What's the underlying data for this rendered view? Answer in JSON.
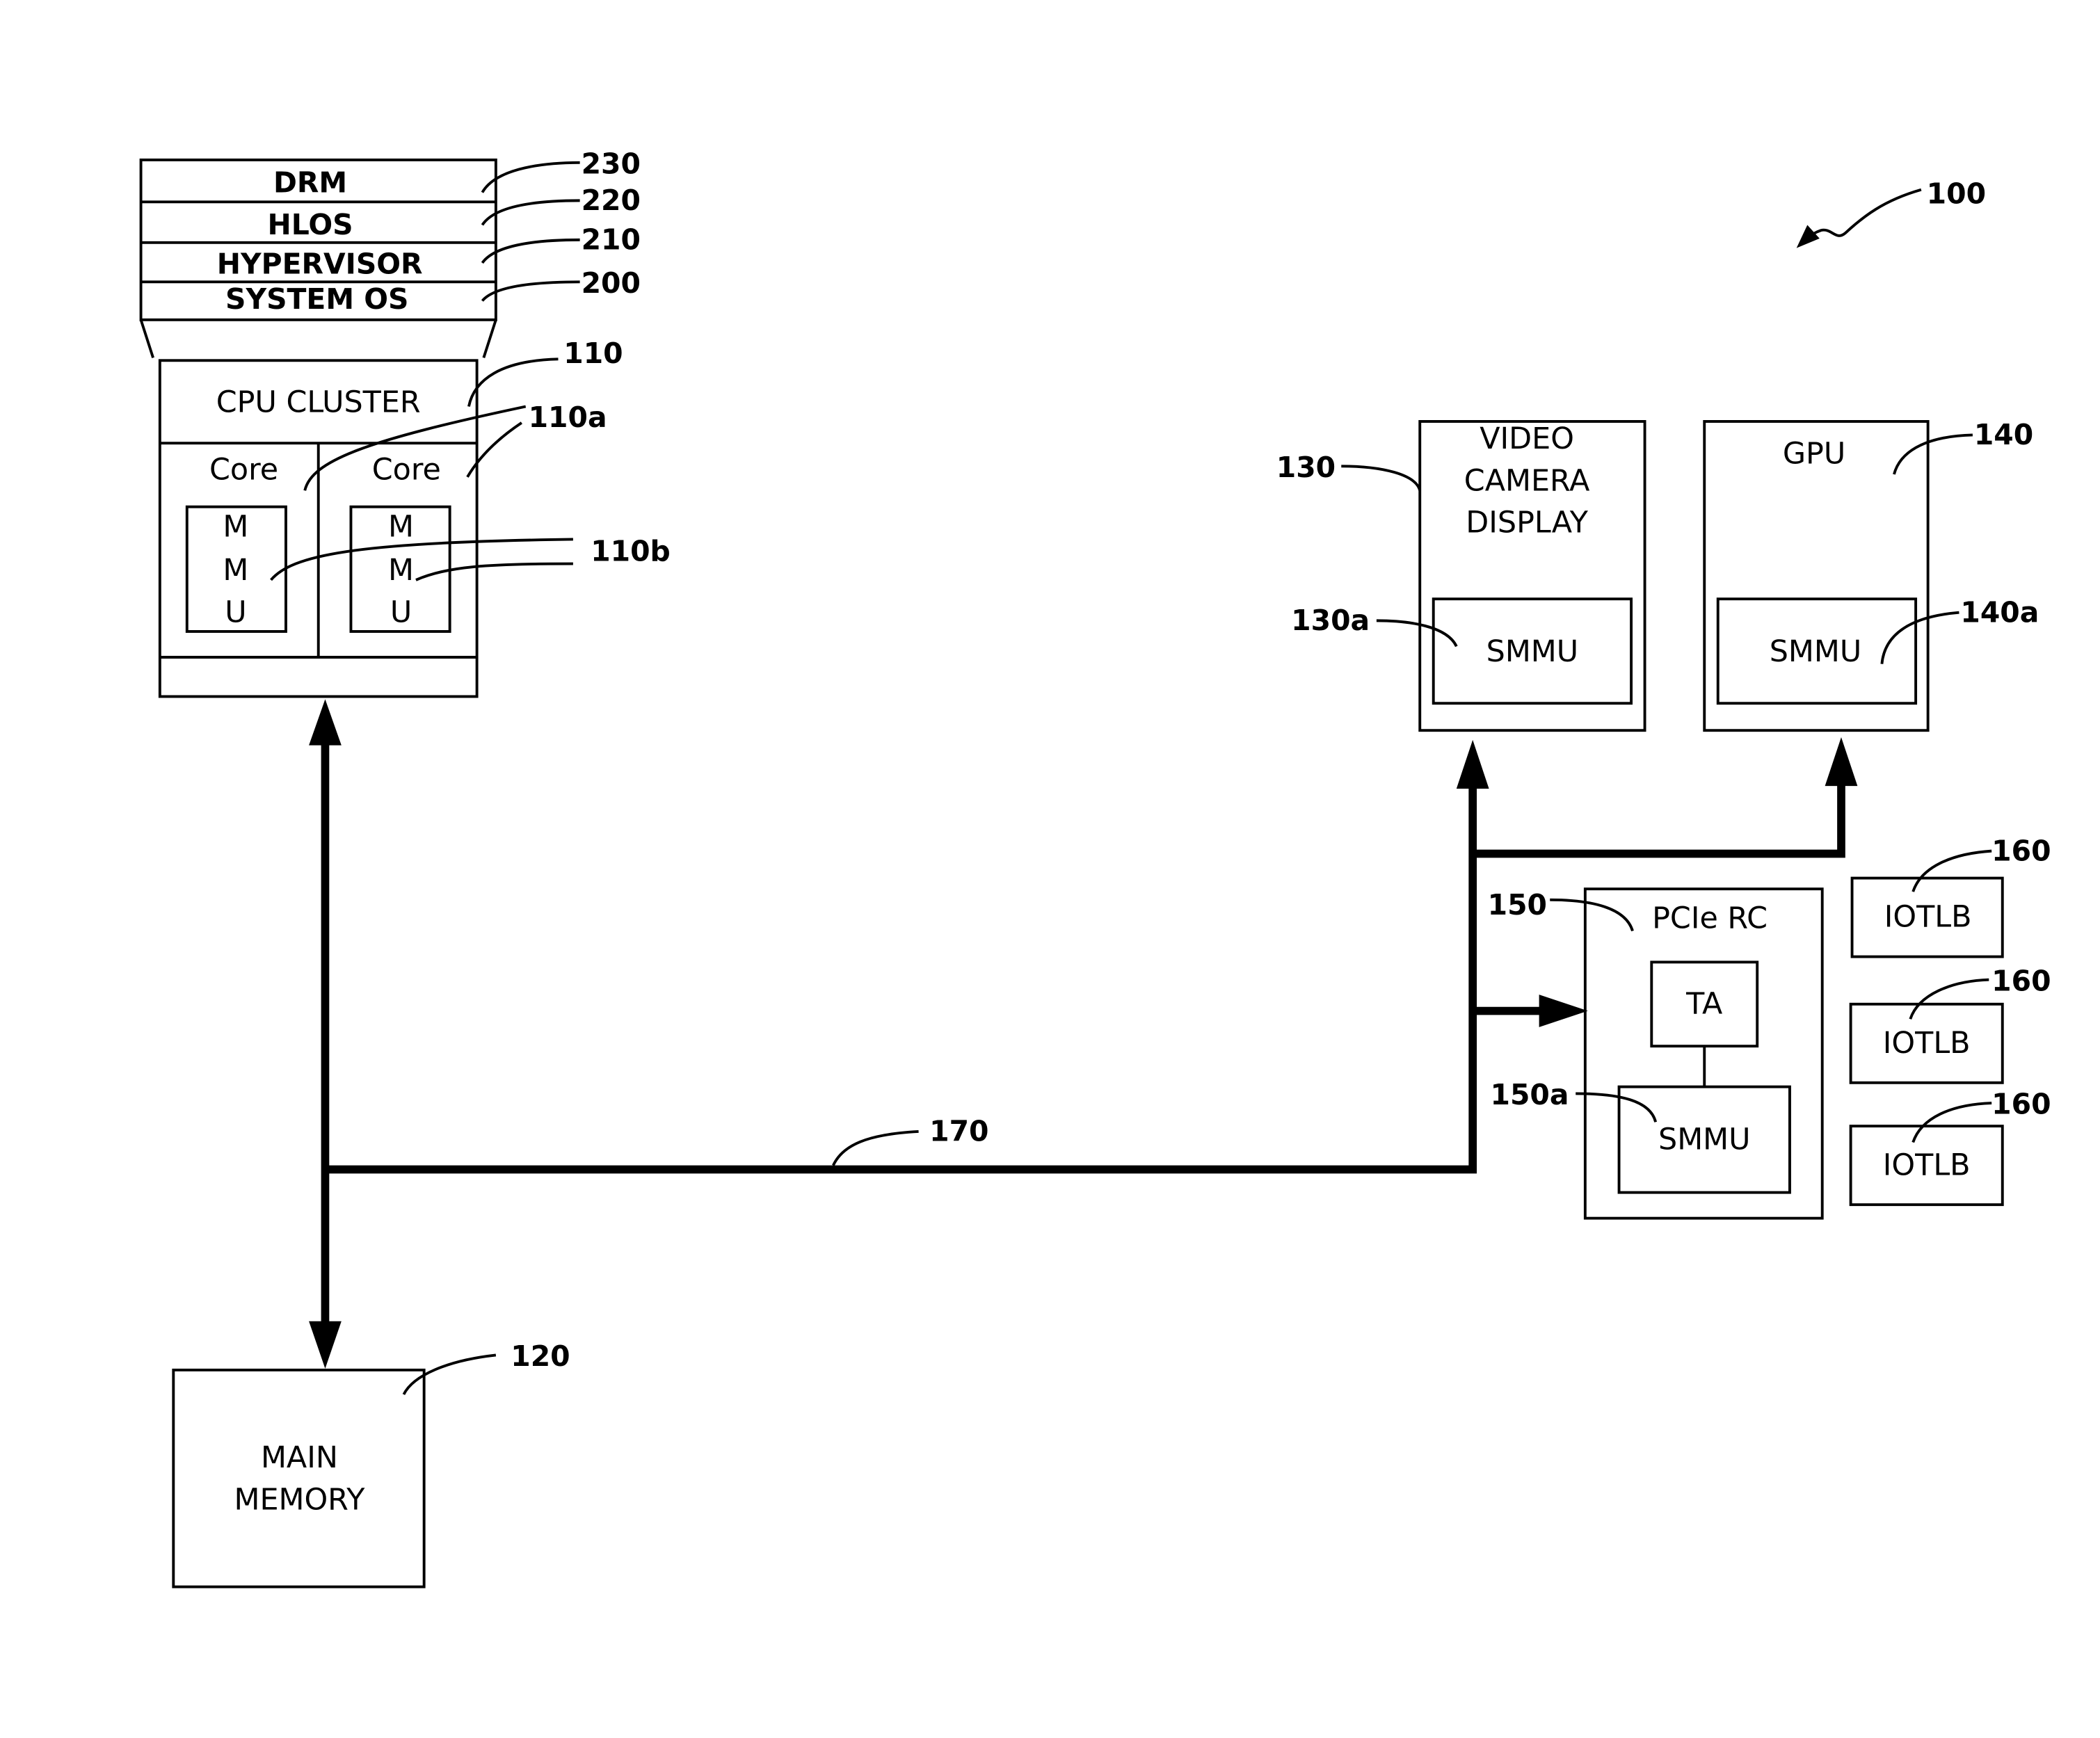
{
  "figure": {
    "reference": "100",
    "os_stack": {
      "layers": [
        {
          "label": "DRM",
          "ref": "230"
        },
        {
          "label": "HLOS",
          "ref": "220"
        },
        {
          "label": "HYPERVISOR",
          "ref": "210"
        },
        {
          "label": "SYSTEM OS",
          "ref": "200"
        }
      ]
    },
    "cpu_cluster": {
      "label": "CPU CLUSTER",
      "ref": "110",
      "core_ref": "110a",
      "mmu_ref": "110b",
      "cores": [
        {
          "label": "Core",
          "mmu_letters": [
            "M",
            "M",
            "U"
          ]
        },
        {
          "label": "Core",
          "mmu_letters": [
            "M",
            "M",
            "U"
          ]
        }
      ]
    },
    "main_memory": {
      "lines": [
        "MAIN",
        "MEMORY"
      ],
      "ref": "120"
    },
    "video": {
      "lines": [
        "VIDEO",
        "CAMERA",
        "DISPLAY"
      ],
      "ref": "130",
      "smmu_label": "SMMU",
      "smmu_ref": "130a"
    },
    "gpu": {
      "label": "GPU",
      "ref": "140",
      "smmu_label": "SMMU",
      "smmu_ref": "140a"
    },
    "pcie": {
      "label": "PCIe RC",
      "ref": "150",
      "ta_label": "TA",
      "smmu_label": "SMMU",
      "smmu_ref": "150a"
    },
    "iotlbs": [
      {
        "label": "IOTLB",
        "ref": "160"
      },
      {
        "label": "IOTLB",
        "ref": "160"
      },
      {
        "label": "IOTLB",
        "ref": "160"
      }
    ],
    "bus": {
      "ref": "170"
    }
  }
}
